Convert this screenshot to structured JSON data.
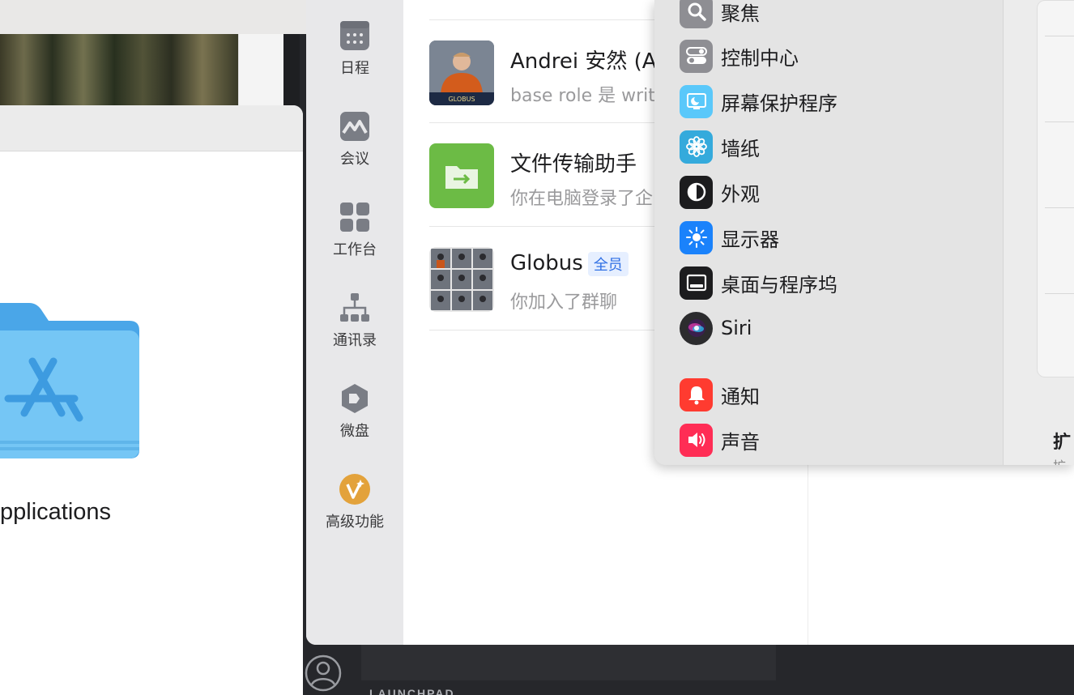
{
  "finder": {
    "folder_label": "pplications"
  },
  "wecom": {
    "nav": [
      {
        "label": "日程",
        "icon": "calendar-icon"
      },
      {
        "label": "会议",
        "icon": "meeting-icon"
      },
      {
        "label": "工作台",
        "icon": "workbench-icon"
      },
      {
        "label": "通讯录",
        "icon": "contacts-icon"
      },
      {
        "label": "微盘",
        "icon": "drive-icon"
      },
      {
        "label": "高级功能",
        "icon": "premium-icon"
      }
    ],
    "chats": [
      {
        "name": "Andrei 安然 (A",
        "preview": "base role 是 writ",
        "badge": ""
      },
      {
        "name": "文件传输助手",
        "preview": "你在电脑登录了企",
        "badge": ""
      },
      {
        "name": "Globus",
        "preview": "你加入了群聊",
        "badge": "全员"
      }
    ],
    "avatar_caption": "GLOBUS"
  },
  "settings": {
    "items": [
      {
        "label": "聚焦",
        "icon": "magnifier-icon",
        "color": "#8e8e93"
      },
      {
        "label": "控制中心",
        "icon": "toggles-icon",
        "color": "#8e8e93"
      },
      {
        "label": "屏幕保护程序",
        "icon": "screensaver-icon",
        "color": "#5ac8fa"
      },
      {
        "label": "墙纸",
        "icon": "flower-icon",
        "color": "#34aadc"
      },
      {
        "label": "外观",
        "icon": "appearance-icon",
        "color": "#1c1c1e"
      },
      {
        "label": "显示器",
        "icon": "sun-icon",
        "color": "#1a82fb"
      },
      {
        "label": "桌面与程序坞",
        "icon": "dock-icon",
        "color": "#1c1c1e"
      },
      {
        "label": "Siri",
        "icon": "siri-icon",
        "color": "#2c2c2e"
      },
      {
        "label": "通知",
        "icon": "bell-icon",
        "color": "#ff3b30"
      },
      {
        "label": "声音",
        "icon": "speaker-icon",
        "color": "#ff2d55"
      }
    ],
    "right_heading": "扩",
    "right_sub": "扩"
  },
  "ide": {
    "bottom_label": "LAUNCHPAD"
  }
}
